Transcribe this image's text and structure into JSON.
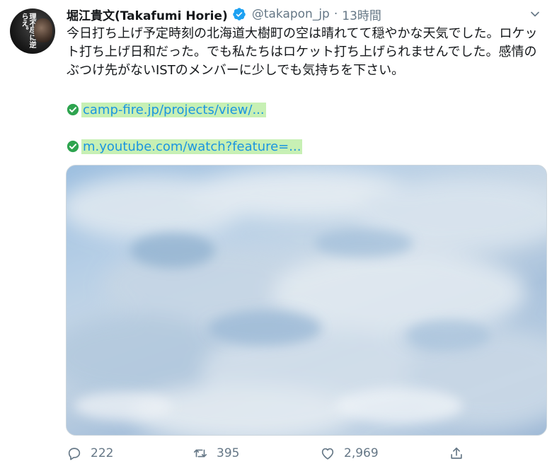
{
  "avatar": {
    "text": "理不尽に逆らえ。"
  },
  "header": {
    "name": "堀江貴文(Takafumi Horie)",
    "handle": "@takapon_jp",
    "separator": "·",
    "time": "13時間",
    "verified_icon": "verified-badge-icon",
    "verified_color": "#1da1f2"
  },
  "tweet": {
    "text": "今日打ち上げ予定時刻の北海道大樹町の空は晴れてて穏やかな天気でした。ロケット打ち上げ日和だった。でも私たちはロケット打ち上げられませんでした。感情のぶつけ先がないISTのメンバーに少しでも気持ちを下さい。",
    "links": [
      {
        "text": "camp-fire.jp/projects/view/...",
        "icon": "check-circle-icon"
      },
      {
        "text": "m.youtube.com/watch?feature=...",
        "icon": "check-circle-icon"
      }
    ]
  },
  "actions": {
    "reply_count": "222",
    "retweet_count": "395",
    "like_count": "2,969"
  },
  "colors": {
    "link": "#1b95e0",
    "link_highlight": "#c7f0b4",
    "check_green": "#2ea44f",
    "muted": "#657786"
  }
}
